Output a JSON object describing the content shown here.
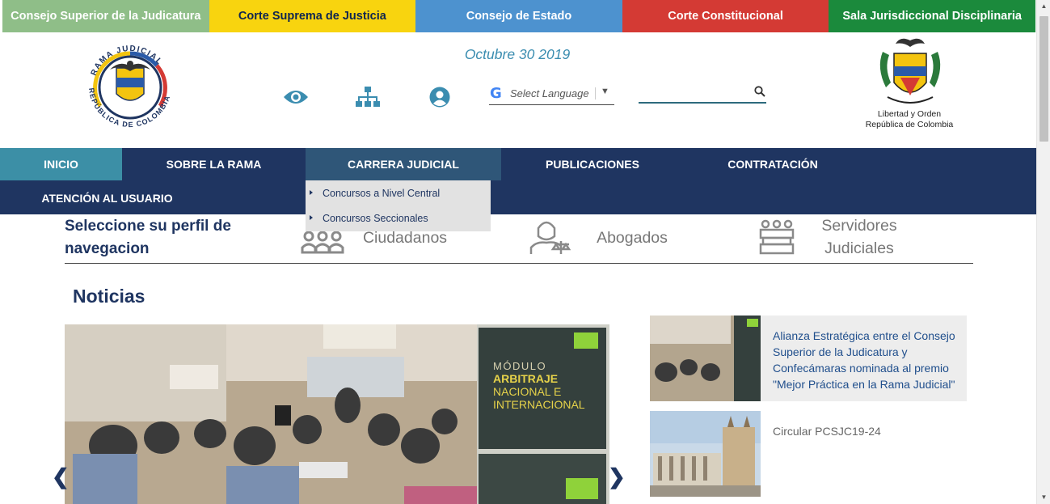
{
  "top_tabs": [
    {
      "label": "Consejo Superior de la Judicatura",
      "color": "#8fbe88"
    },
    {
      "label": "Corte Suprema de Justicia",
      "color": "#f8d40f"
    },
    {
      "label": "Consejo de Estado",
      "color": "#4d92cf"
    },
    {
      "label": "Corte Constitucional",
      "color": "#d43a34"
    },
    {
      "label": "Sala Jurisdiccional Disciplinaria",
      "color": "#1b8a3c"
    }
  ],
  "header": {
    "logo_left_text_top": "RAMA JUDICIAL",
    "logo_left_text_bottom": "REPÚBLICA DE COLOMBIA",
    "date": "Octubre 30 2019",
    "icons": [
      "eye-icon",
      "sitemap-icon",
      "user-icon"
    ],
    "language": {
      "g": "G",
      "label": "Select Language",
      "arrow": "▼"
    },
    "search": {
      "placeholder": ""
    },
    "motto_line1": "Libertad y Orden",
    "motto_line2": "República de Colombia"
  },
  "nav": {
    "items": [
      {
        "label": "INICIO",
        "state": "active"
      },
      {
        "label": "SOBRE LA RAMA"
      },
      {
        "label": "CARRERA JUDICIAL",
        "state": "open"
      },
      {
        "label": "PUBLICACIONES"
      },
      {
        "label": "CONTRATACIÓN"
      },
      {
        "label": "ATENCIÓN AL USUARIO"
      }
    ],
    "dropdown": [
      "Concursos a Nivel Central",
      "Concursos Seccionales"
    ]
  },
  "profile": {
    "title": "Seleccione su perfil de navegacion",
    "options": [
      {
        "label": "Ciudadanos",
        "icon": "citizens-icon"
      },
      {
        "label": "Abogados",
        "icon": "lawyer-icon"
      },
      {
        "label": "Servidores Judiciales",
        "icon": "judicial-servants-icon"
      }
    ]
  },
  "news": {
    "title": "Noticias",
    "slide": {
      "book_line1": "MÓDULO",
      "book_line2": "ARBITRAJE",
      "book_line3": "NACIONAL E",
      "book_line4": "INTERNACIONAL"
    },
    "prev": "❮",
    "next": "❯",
    "cards": [
      {
        "text": "Alianza Estratégica entre el Consejo Superior de la Judicatura y Confecámaras nominada al premio \"Mejor Práctica en la Rama Judicial\""
      },
      {
        "text": "Circular PCSJC19-24"
      }
    ]
  }
}
